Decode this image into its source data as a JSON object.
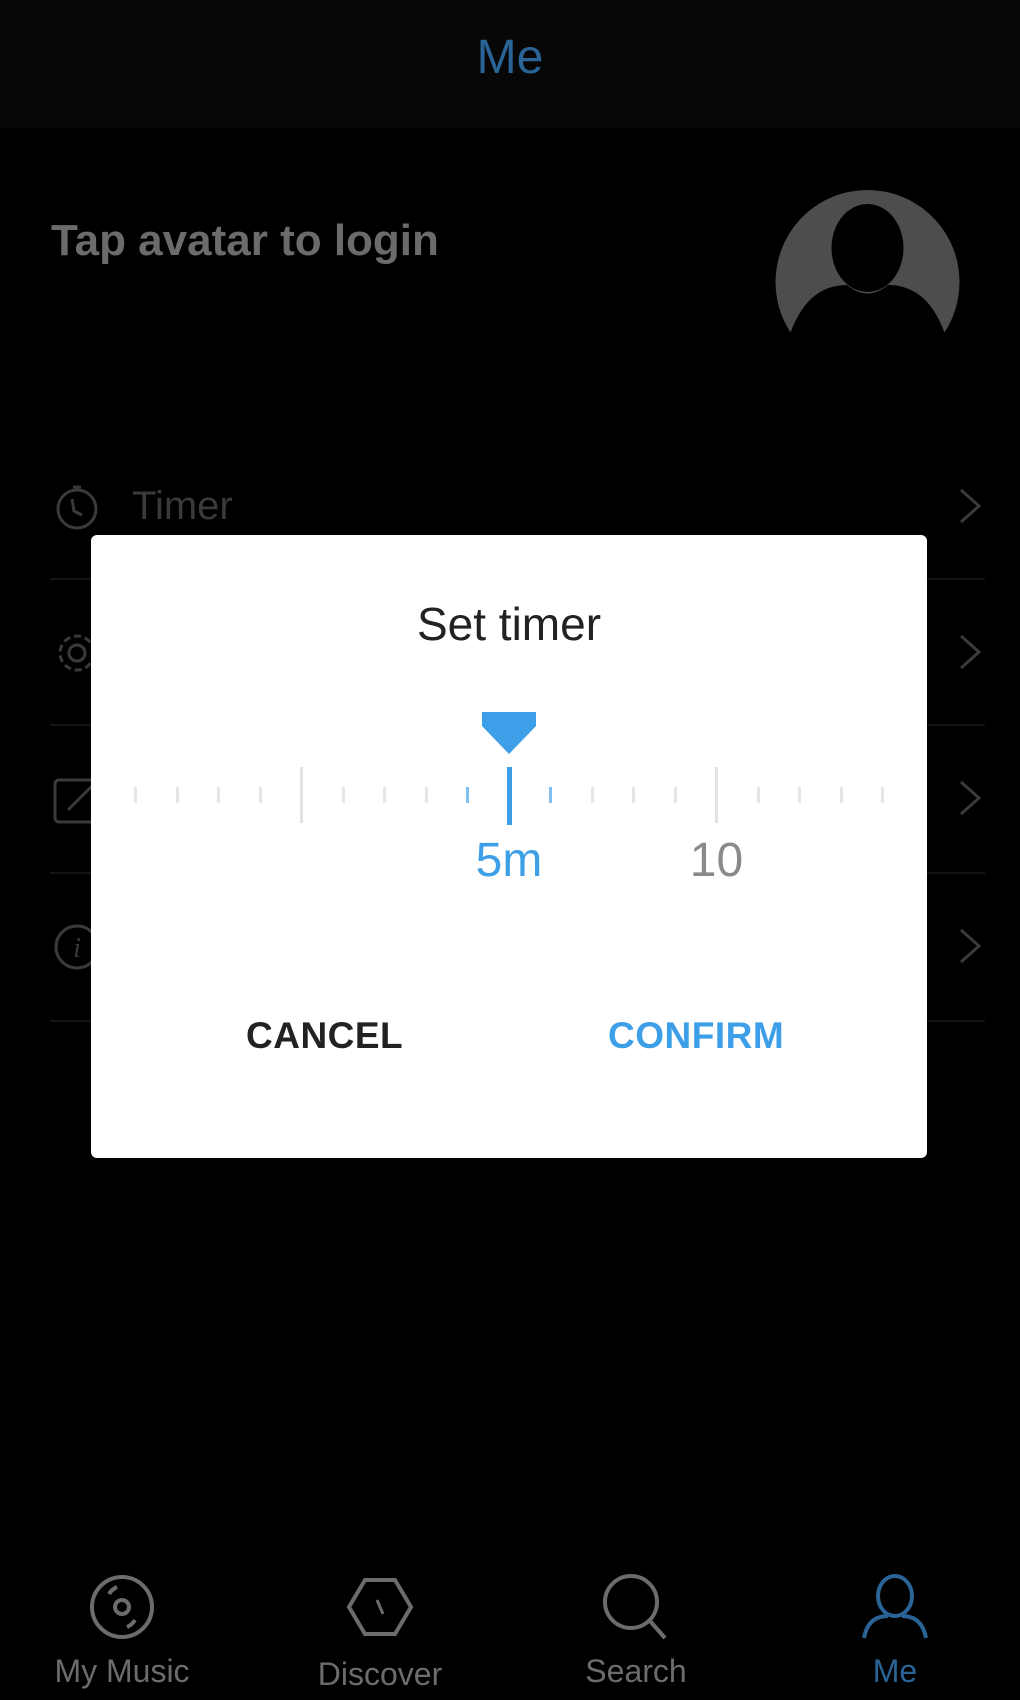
{
  "header": {
    "title": "Me"
  },
  "profile": {
    "login_prompt": "Tap avatar to login",
    "avatar_icon": "user-avatar-icon"
  },
  "menu": {
    "items": [
      {
        "label": "Timer",
        "icon": "stopwatch-icon"
      },
      {
        "label": "",
        "icon": "gear-icon"
      },
      {
        "label": "",
        "icon": "edit-icon"
      },
      {
        "label": "",
        "icon": "info-icon"
      }
    ]
  },
  "dialog": {
    "title": "Set timer",
    "ruler": {
      "selected_value": 5,
      "unit": "m",
      "selected_label": "5m",
      "labels": [
        {
          "value": 10,
          "text": "10"
        }
      ],
      "major_step": 5,
      "visible_min": -4,
      "visible_max": 14
    },
    "cancel_label": "CANCEL",
    "confirm_label": "CONFIRM",
    "accent_color": "#3d9fe8"
  },
  "tabbar": {
    "tabs": [
      {
        "label": "My Music",
        "icon": "disc-icon",
        "active": false
      },
      {
        "label": "Discover",
        "icon": "hexagon-compass-icon",
        "active": false
      },
      {
        "label": "Search",
        "icon": "search-icon",
        "active": false
      },
      {
        "label": "Me",
        "icon": "person-icon",
        "active": true
      }
    ],
    "active_color": "#2a6496"
  }
}
